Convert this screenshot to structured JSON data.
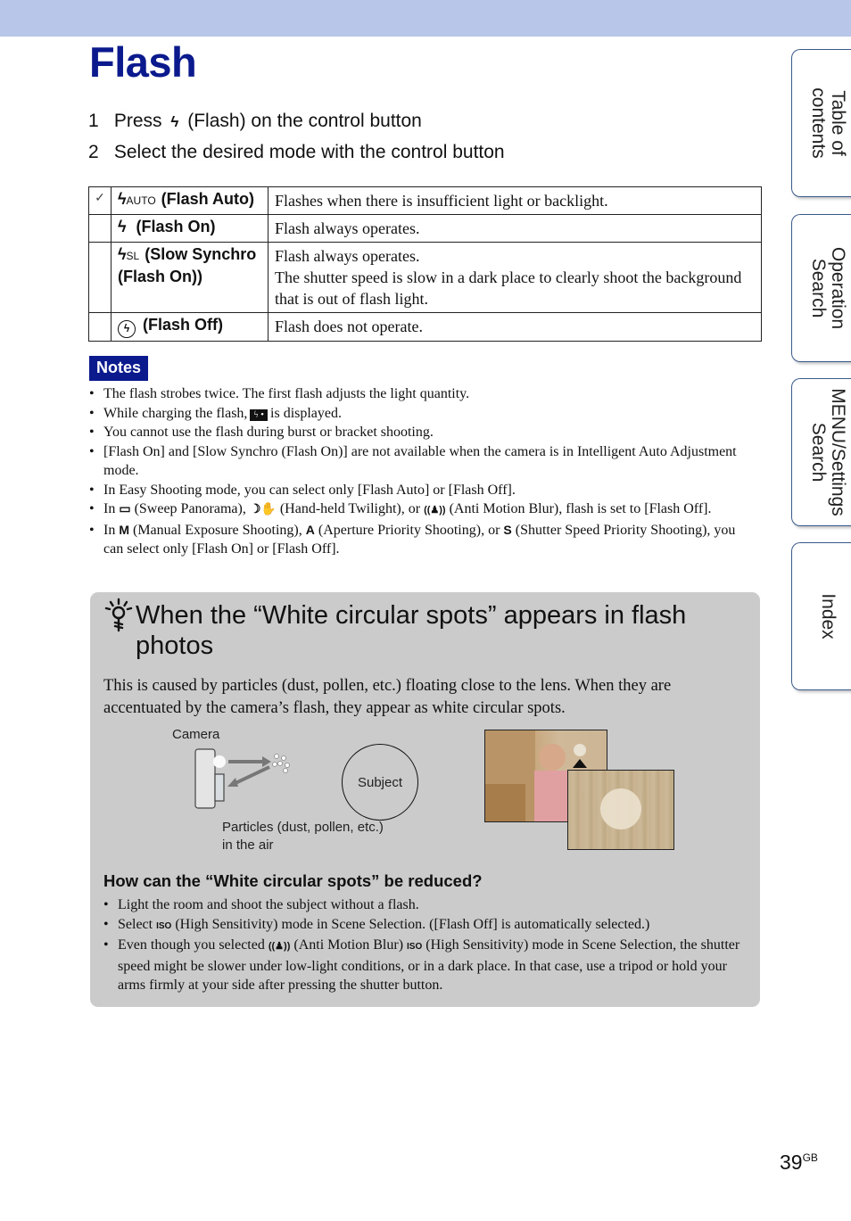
{
  "header": {
    "title": "Flash"
  },
  "steps": [
    {
      "num": "1",
      "pre": "Press",
      "icon": "flash-icon",
      "glyph": "ϟ",
      "post": "(Flash) on the control button"
    },
    {
      "num": "2",
      "text": "Select the desired mode with the control button"
    }
  ],
  "modes": [
    {
      "default": true,
      "check_glyph": "✓",
      "icon": "flash-auto-icon",
      "icon_glyph": "ϟ",
      "icon_suffix": "AUTO",
      "label": "(Flash Auto)",
      "desc": [
        "Flashes when there is insufficient light or backlight."
      ]
    },
    {
      "default": false,
      "icon": "flash-on-icon",
      "icon_glyph": "ϟ",
      "icon_suffix": "",
      "label": "(Flash On)",
      "desc": [
        "Flash always operates."
      ]
    },
    {
      "default": false,
      "icon": "slow-synchro-icon",
      "icon_glyph": "ϟ",
      "icon_suffix": "SL",
      "label": "(Slow Synchro (Flash On))",
      "desc": [
        "Flash always operates.",
        "The shutter speed is slow in a dark place to clearly shoot the background that is out of flash light."
      ]
    },
    {
      "default": false,
      "icon": "flash-off-icon",
      "icon_glyph": "ϟ",
      "icon_suffix": "",
      "label": "(Flash Off)",
      "desc": [
        "Flash does not operate."
      ]
    }
  ],
  "notes": {
    "badge": "Notes",
    "items": [
      "The flash strobes twice. The first flash adjusts the light quantity.",
      "While charging the flash, [charging-icon] is displayed.",
      "You cannot use the flash during burst or bracket shooting.",
      "[Flash On] and [Slow Synchro (Flash On)] are not available when the camera is in Intelligent Auto Adjustment mode.",
      "In Easy Shooting mode, you can select only [Flash Auto] or [Flash Off].",
      "In [sweep-panorama-icon] (Sweep Panorama), [hand-held-twilight-icon] (Hand-held Twilight), or [anti-motion-blur-icon] (Anti Motion Blur), flash is set to [Flash Off].",
      "In [M] (Manual Exposure Shooting), [A] (Aperture Priority Shooting), or [S] (Shutter Speed Priority Shooting), you can select only [Flash On] or [Flash Off]."
    ],
    "n2_pre": "While charging the flash,",
    "n2_icon": "ϟ •",
    "n2_post": "is displayed.",
    "n6_a": "In",
    "n6_b": "(Sweep Panorama),",
    "n6_c": "(Hand-held Twilight), or",
    "n6_d": "(Anti Motion Blur), flash is set to [Flash Off].",
    "n7_a": "In",
    "n7_M": "M",
    "n7_b": "(Manual Exposure Shooting),",
    "n7_A": "A",
    "n7_c": "(Aperture Priority Shooting), or",
    "n7_S": "S",
    "n7_d": "(Shutter Speed Priority Shooting), you can select only [Flash On] or [Flash Off]."
  },
  "tip": {
    "title": "When the “White circular spots” appears in flash photos",
    "body": "This is caused by particles (dust, pollen, etc.) floating close to the lens. When they are accentuated by the camera’s flash, they appear as white circular spots.",
    "diagram": {
      "camera_label": "Camera",
      "subject_label": "Subject",
      "particles_label_1": "Particles (dust, pollen, etc.)",
      "particles_label_2": "in the air"
    },
    "reduce_heading": "How can the “White circular spots” be reduced?",
    "reduce_items": {
      "r1": "Light the room and shoot the subject without a flash.",
      "r2_pre": "Select",
      "r2_post": "(High Sensitivity) mode in Scene Selection. ([Flash Off] is automatically selected.)",
      "r3_pre": "Even though you selected",
      "r3_mid": "(Anti Motion Blur)",
      "r3_post": "(High Sensitivity) mode in Scene Selection, the shutter speed might be slower under low-light conditions, or in a dark place. In that case, use a tripod or hold your arms firmly at your side after pressing the shutter button."
    },
    "iso_glyph": "ISO",
    "amb_glyph": "((♟))"
  },
  "side_tabs": [
    {
      "label": "Table of\ncontents"
    },
    {
      "label": "Operation\nSearch"
    },
    {
      "label": "MENU/Settings\nSearch"
    },
    {
      "label": "Index"
    }
  ],
  "page": {
    "number": "39",
    "suffix": "GB"
  }
}
